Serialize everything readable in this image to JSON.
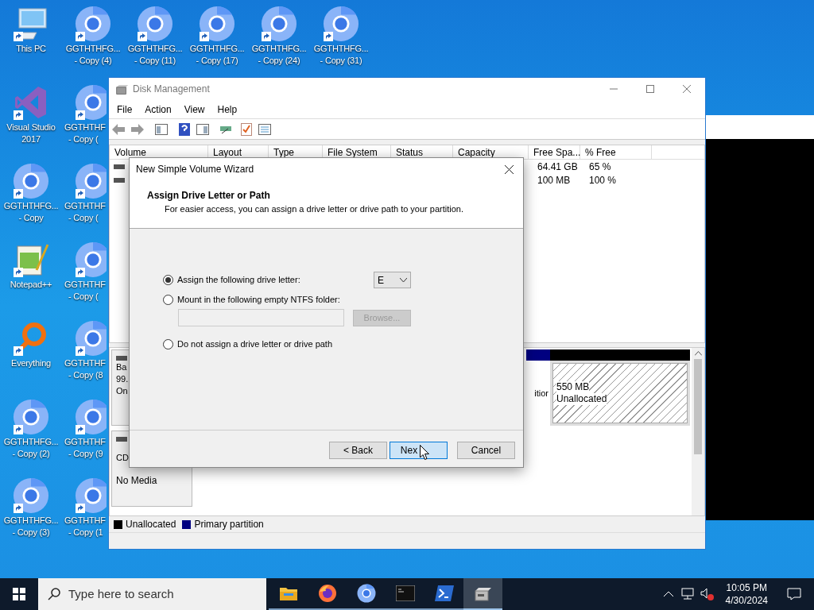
{
  "desktop": {
    "columns": [
      [
        {
          "kind": "pc",
          "lines": [
            "This PC"
          ]
        },
        {
          "kind": "vs",
          "lines": [
            "Visual Studio",
            "2017"
          ]
        },
        {
          "kind": "browser",
          "lines": [
            "GGTHTHFG...",
            "- Copy"
          ]
        },
        {
          "kind": "notepad",
          "lines": [
            "Notepad++"
          ]
        },
        {
          "kind": "finder",
          "lines": [
            "Everything"
          ]
        },
        {
          "kind": "browser",
          "lines": [
            "GGTHTHFG...",
            "- Copy (2)"
          ]
        },
        {
          "kind": "browser",
          "lines": [
            "GGTHTHFG...",
            "- Copy (3)"
          ]
        }
      ],
      [
        {
          "kind": "browser",
          "lines": [
            "GGTHTHFG...",
            "- Copy (4)"
          ]
        },
        {
          "kind": "browser",
          "lines": [
            "GGTHTHF",
            "- Copy ("
          ]
        },
        {
          "kind": "browser",
          "lines": [
            "GGTHTHF",
            "- Copy ("
          ]
        },
        {
          "kind": "browser",
          "lines": [
            "GGTHTHF",
            "- Copy ("
          ]
        },
        {
          "kind": "browser",
          "lines": [
            "GGTHTHF",
            "- Copy (8"
          ]
        },
        {
          "kind": "browser",
          "lines": [
            "GGTHTHF",
            "- Copy (9"
          ]
        },
        {
          "kind": "browser",
          "lines": [
            "GGTHTHF",
            "- Copy (1"
          ]
        }
      ],
      [
        {
          "kind": "browser",
          "lines": [
            "GGTHTHFG...",
            "- Copy (11)"
          ]
        }
      ],
      [
        {
          "kind": "browser",
          "lines": [
            "GGTHTHFG...",
            "- Copy (17)"
          ]
        }
      ],
      [
        {
          "kind": "browser",
          "lines": [
            "GGTHTHFG...",
            "- Copy (24)"
          ]
        }
      ],
      [
        {
          "kind": "browser",
          "lines": [
            "GGTHTHFG...",
            "- Copy (31)"
          ]
        }
      ]
    ]
  },
  "disk_management": {
    "title": "Disk Management",
    "menu": [
      "File",
      "Action",
      "View",
      "Help"
    ],
    "columns": [
      "Volume",
      "Layout",
      "Type",
      "File System",
      "Status",
      "Capacity",
      "Free Spa...",
      "% Free"
    ],
    "rows": [
      {
        "free_space": "64.41 GB",
        "percent_free": "65 %"
      },
      {
        "free_space": "100 MB",
        "percent_free": "100 %"
      }
    ],
    "disks": [
      {
        "label_lines": [
          "Ba",
          "99.",
          "On"
        ],
        "partition_text": "itior",
        "unallocated": [
          "550 MB",
          "Unallocated"
        ]
      },
      {
        "label_lines": [
          "CD"
        ],
        "status": "No Media"
      }
    ],
    "legend": [
      {
        "label": "Unallocated",
        "color": "#000000"
      },
      {
        "label": "Primary partition",
        "color": "#000080"
      }
    ]
  },
  "wizard": {
    "title": "New Simple Volume Wizard",
    "heading": "Assign Drive Letter or Path",
    "subtitle": "For easier access, you can assign a drive letter or drive path to your partition.",
    "options": [
      {
        "label": "Assign the following drive letter:",
        "selected": true
      },
      {
        "label": "Mount in the following empty NTFS folder:",
        "selected": false
      },
      {
        "label": "Do not assign a drive letter or drive path",
        "selected": false
      }
    ],
    "drive_letter": "E",
    "browse": {
      "label": "Browse...",
      "disabled": true
    },
    "buttons": [
      {
        "label": "< Back",
        "default": false
      },
      {
        "label": "Nex",
        "default": true
      },
      {
        "label": "Cancel",
        "default": false
      }
    ]
  },
  "taskbar": {
    "search_placeholder": "Type here to search",
    "apps": [
      {
        "kind": "folder",
        "selected": false
      },
      {
        "kind": "firefox",
        "selected": false
      },
      {
        "kind": "browser",
        "selected": false
      },
      {
        "kind": "terminal",
        "selected": false
      },
      {
        "kind": "powershell",
        "selected": false
      },
      {
        "kind": "disk",
        "selected": true
      }
    ],
    "time": "10:05 PM",
    "date": "4/30/2024"
  }
}
